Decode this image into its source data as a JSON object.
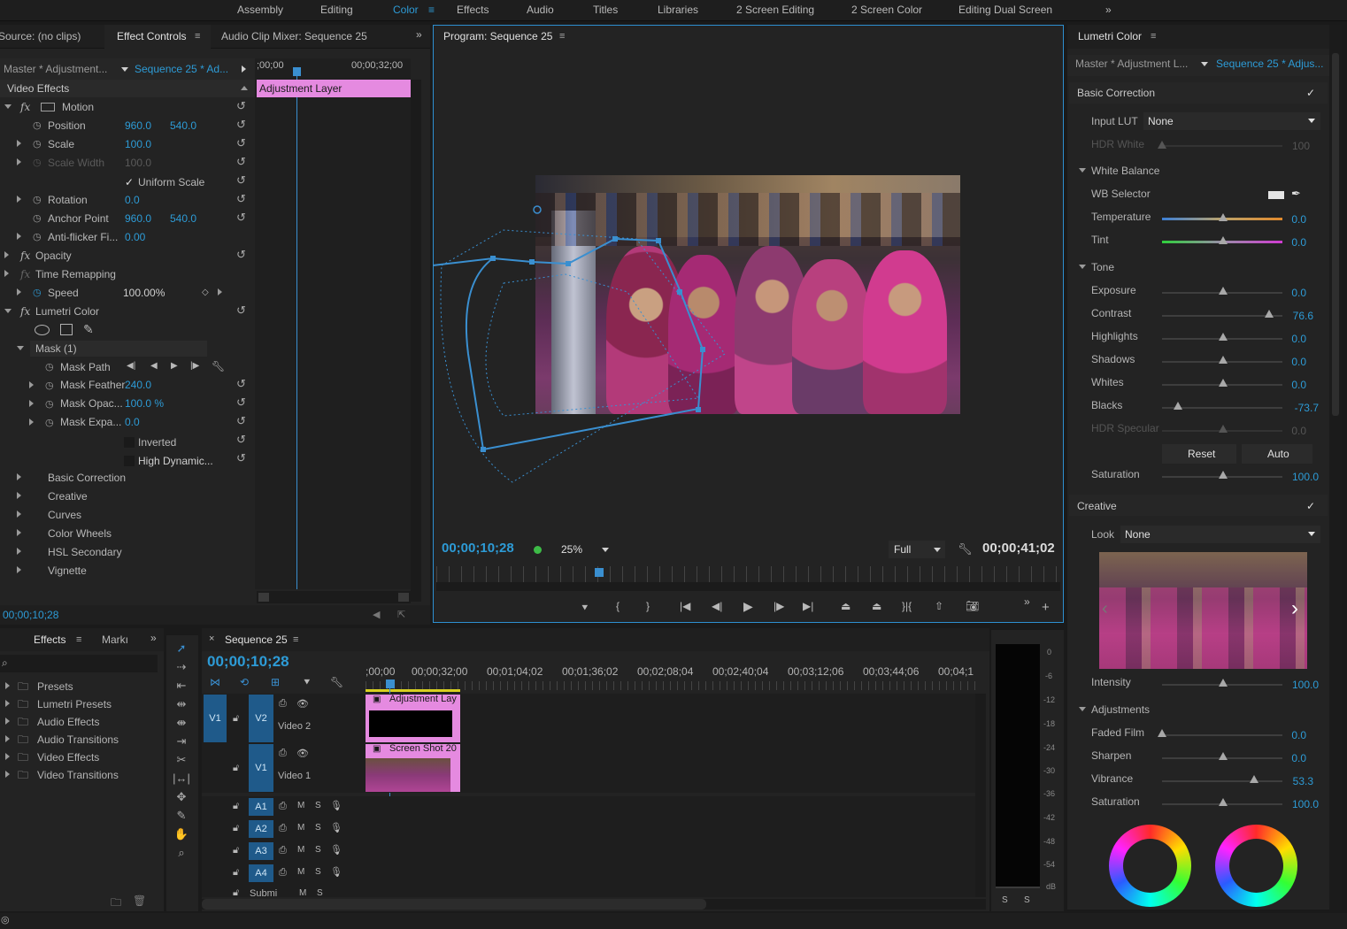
{
  "workspaces": {
    "tabs": [
      "Assembly",
      "Editing",
      "Color",
      "Effects",
      "Audio",
      "Titles",
      "Libraries",
      "2 Screen Editing",
      "2 Screen Color",
      "Editing Dual Screen"
    ],
    "active": "Color",
    "overflow": "»"
  },
  "source_panel": {
    "source_tab": "Source: (no clips)",
    "effect_controls_tab": "Effect Controls",
    "audio_mixer_tab": "Audio Clip Mixer: Sequence 25",
    "overflow": "»",
    "master_label": "Master * Adjustment...",
    "sequence_label": "Sequence 25 * Ad...",
    "timecode_start": ";00;00",
    "timecode_end": "00;00;32;00",
    "clip_label": "Adjustment Layer",
    "video_effects_header": "Video Effects",
    "current_time": "00;00;10;28",
    "rows": {
      "motion": "Motion",
      "position": "Position",
      "position_x": "960.0",
      "position_y": "540.0",
      "scale": "Scale",
      "scale_val": "100.0",
      "scale_width": "Scale Width",
      "scale_width_val": "100.0",
      "uniform_scale": "Uniform Scale",
      "rotation": "Rotation",
      "rotation_val": "0.0",
      "anchor_point": "Anchor Point",
      "anchor_x": "960.0",
      "anchor_y": "540.0",
      "anti_flicker": "Anti-flicker Fi...",
      "anti_flicker_val": "0.00",
      "opacity": "Opacity",
      "time_remapping": "Time Remapping",
      "speed": "Speed",
      "speed_val": "100.00%",
      "lumetri_color": "Lumetri Color",
      "mask": "Mask (1)",
      "mask_path": "Mask Path",
      "mask_feather": "Mask Feather",
      "mask_feather_val": "240.0",
      "mask_opacity": "Mask Opac...",
      "mask_opacity_val": "100.0 %",
      "mask_expansion": "Mask Expa...",
      "mask_expansion_val": "0.0",
      "inverted": "Inverted",
      "high_dynamic": "High Dynamic...",
      "basic_correction": "Basic Correction",
      "creative": "Creative",
      "curves": "Curves",
      "color_wheels": "Color Wheels",
      "hsl_secondary": "HSL Secondary",
      "vignette": "Vignette"
    }
  },
  "program": {
    "title": "Program: Sequence 25",
    "timecode": "00;00;10;28",
    "zoom": "25%",
    "quality": "Full",
    "duration": "00;00;41;02"
  },
  "lumetri": {
    "title": "Lumetri Color",
    "master_label": "Master * Adjustment L...",
    "sequence_label": "Sequence 25 * Adjus...",
    "basic_correction": "Basic Correction",
    "input_lut_label": "Input LUT",
    "input_lut_value": "None",
    "hdr_white_label": "HDR White",
    "hdr_white_value": "100",
    "white_balance": "White Balance",
    "wb_selector": "WB Selector",
    "temperature_label": "Temperature",
    "temperature_value": "0.0",
    "tint_label": "Tint",
    "tint_value": "0.0",
    "tone": "Tone",
    "exposure_label": "Exposure",
    "exposure_value": "0.0",
    "contrast_label": "Contrast",
    "contrast_value": "76.6",
    "highlights_label": "Highlights",
    "highlights_value": "0.0",
    "shadows_label": "Shadows",
    "shadows_value": "0.0",
    "whites_label": "Whites",
    "whites_value": "0.0",
    "blacks_label": "Blacks",
    "blacks_value": "-73.7",
    "hdr_specular_label": "HDR Specular",
    "hdr_specular_value": "0.0",
    "reset_button": "Reset",
    "auto_button": "Auto",
    "saturation_label": "Saturation",
    "saturation_value": "100.0",
    "creative": "Creative",
    "look_label": "Look",
    "look_value": "None",
    "intensity_label": "Intensity",
    "intensity_value": "100.0",
    "adjustments": "Adjustments",
    "faded_film_label": "Faded Film",
    "faded_film_value": "0.0",
    "sharpen_label": "Sharpen",
    "sharpen_value": "0.0",
    "vibrance_label": "Vibrance",
    "vibrance_value": "53.3",
    "adj_saturation_label": "Saturation",
    "adj_saturation_value": "100.0"
  },
  "effects_panel": {
    "tab": "Effects",
    "markers_tab": "Markı",
    "overflow": "»",
    "items": [
      "Presets",
      "Lumetri Presets",
      "Audio Effects",
      "Audio Transitions",
      "Video Effects",
      "Video Transitions"
    ]
  },
  "timeline": {
    "tab": "Sequence 25",
    "timecode": "00;00;10;28",
    "ruler": [
      ";00;00",
      "00;00;32;00",
      "00;01;04;02",
      "00;01;36;02",
      "00;02;08;04",
      "00;02;40;04",
      "00;03;12;06",
      "00;03;44;06",
      "00;04;1"
    ],
    "tracks": {
      "v1_src": "V1",
      "v2": "V2",
      "v2_name": "Video 2",
      "v1": "V1",
      "v1_name": "Video 1",
      "a1": "A1",
      "a2": "A2",
      "a3": "A3",
      "a4": "A4",
      "submix": "Submi",
      "m": "M",
      "s": "S"
    },
    "clip_adjustment": "Adjustment Lay",
    "clip_screenshot": "Screen Shot 20"
  },
  "meter": {
    "labels": [
      "0",
      "-6",
      "-12",
      "-18",
      "-24",
      "-30",
      "-36",
      "-42",
      "-48",
      "-54",
      "dB"
    ],
    "solo_left": "S",
    "solo_right": "S"
  }
}
